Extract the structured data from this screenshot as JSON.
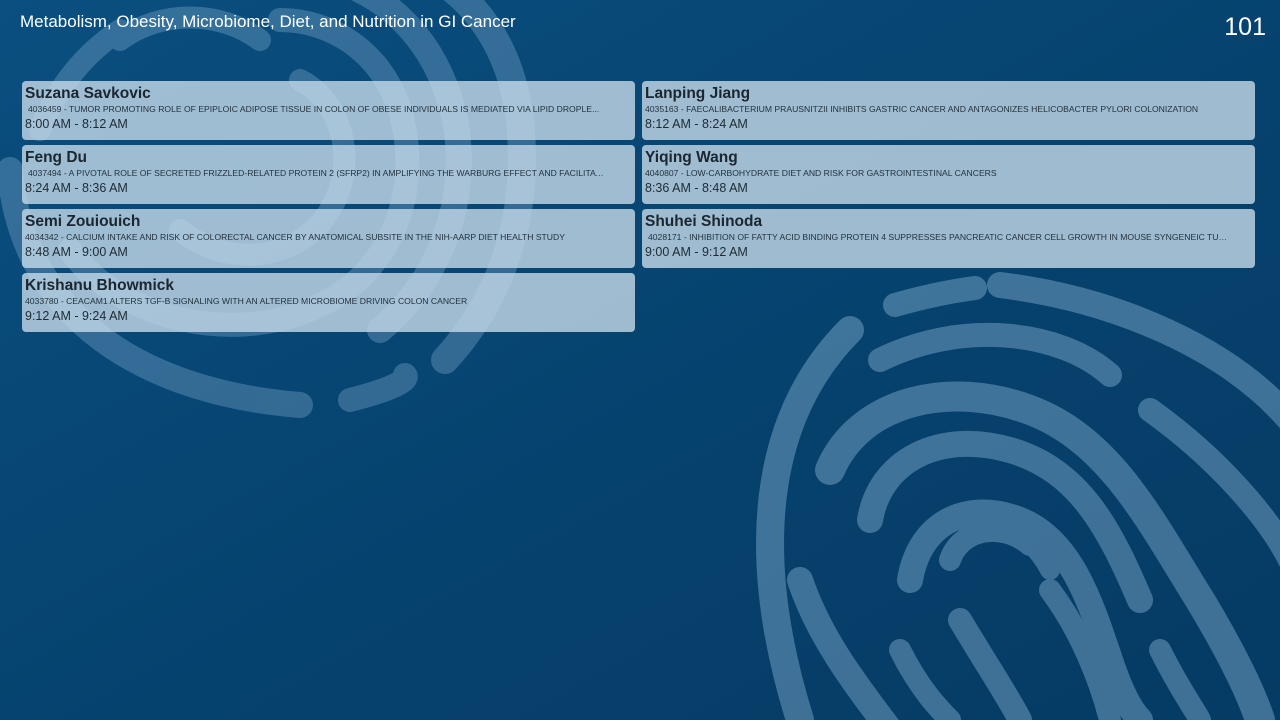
{
  "header": {
    "session_title": "Metabolism, Obesity, Microbiome, Diet, and Nutrition in GI Cancer",
    "room_number": "101"
  },
  "colors": {
    "background": "#073f6b",
    "card": "#c6dae8",
    "decor_stripes": "#8fb9d9"
  },
  "presentations": [
    {
      "presenter": "Suzana Savkovic",
      "abstract": "4036459 - TUMOR PROMOTING ROLE OF EPIPLOIC ADIPOSE TISSUE IN COLON OF OBESE INDIVIDUALS IS MEDIATED VIA LIPID DROPLE...",
      "time": "8:00 AM - 8:12 AM"
    },
    {
      "presenter": "Lanping Jiang",
      "abstract": "4035163 - FAECALIBACTERIUM PRAUSNITZII INHIBITS GASTRIC CANCER AND ANTAGONIZES HELICOBACTER PYLORI COLONIZATION",
      "time": "8:12 AM - 8:24 AM"
    },
    {
      "presenter": "Feng Du",
      "abstract": "4037494 - A PIVOTAL ROLE OF SECRETED FRIZZLED-RELATED PROTEIN 2 (SFRP2) IN AMPLIFYING THE WARBURG EFFECT AND FACILITATI...",
      "time": "8:24 AM - 8:36 AM"
    },
    {
      "presenter": "Yiqing Wang",
      "abstract": "4040807 - LOW-CARBOHYDRATE DIET AND RISK FOR GASTROINTESTINAL CANCERS",
      "time": "8:36 AM - 8:48 AM"
    },
    {
      "presenter": "Semi Zouiouich",
      "abstract": "4034342 - CALCIUM INTAKE AND RISK OF COLORECTAL CANCER BY ANATOMICAL SUBSITE IN THE NIH-AARP DIET HEALTH STUDY",
      "time": "8:48 AM - 9:00 AM"
    },
    {
      "presenter": "Shuhei Shinoda",
      "abstract": "4028171 - INHIBITION OF FATTY ACID BINDING PROTEIN 4 SUPPRESSES PANCREATIC CANCER CELL GROWTH IN MOUSE SYNGENEIC TUM...",
      "time": "9:00 AM - 9:12 AM"
    },
    {
      "presenter": "Krishanu Bhowmick",
      "abstract": "4033780 - CEACAM1 ALTERS TGF-β SIGNALING WITH AN ALTERED MICROBIOME DRIVING COLON CANCER",
      "time": "9:12 AM - 9:24 AM"
    }
  ]
}
